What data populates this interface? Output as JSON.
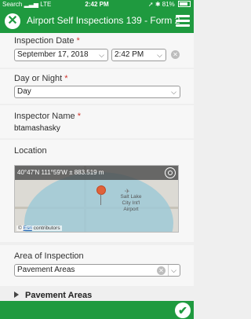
{
  "status_bar": {
    "left": "Search",
    "network": "LTE",
    "time": "2:42 PM",
    "battery_pct": "81%"
  },
  "header": {
    "title": "Airport Self Inspections 139 - Form 2"
  },
  "inspection_date": {
    "label": "Inspection Date",
    "required_mark": "*",
    "date_value": "September 17, 2018",
    "time_value": "2:42 PM"
  },
  "day_or_night": {
    "label": "Day or Night",
    "required_mark": "*",
    "value": "Day"
  },
  "inspector": {
    "label": "Inspector Name",
    "required_mark": "*",
    "value": "btamashasky"
  },
  "location": {
    "label": "Location",
    "coordinates": "40°47'N 111°59'W ± 883.519 m",
    "map_place_label": "Salt Lake City Int'l Airport",
    "attribution_prefix": "©",
    "attribution_link": "Esri",
    "attribution_suffix": "contributors"
  },
  "area_of_inspection": {
    "label": "Area of Inspection",
    "value": "Pavement Areas"
  },
  "section": {
    "title": "Pavement Areas"
  },
  "icons": {
    "close": "close-icon",
    "menu": "hamburger-menu-icon",
    "chevron": "chevron-down-icon",
    "clear": "clear-icon",
    "locate": "locate-icon",
    "pin": "map-pin-icon",
    "expand": "expand-triangle-icon",
    "submit": "checkmark-icon"
  },
  "colors": {
    "brand_green": "#1f9a3f",
    "required_red": "#d0342c"
  }
}
